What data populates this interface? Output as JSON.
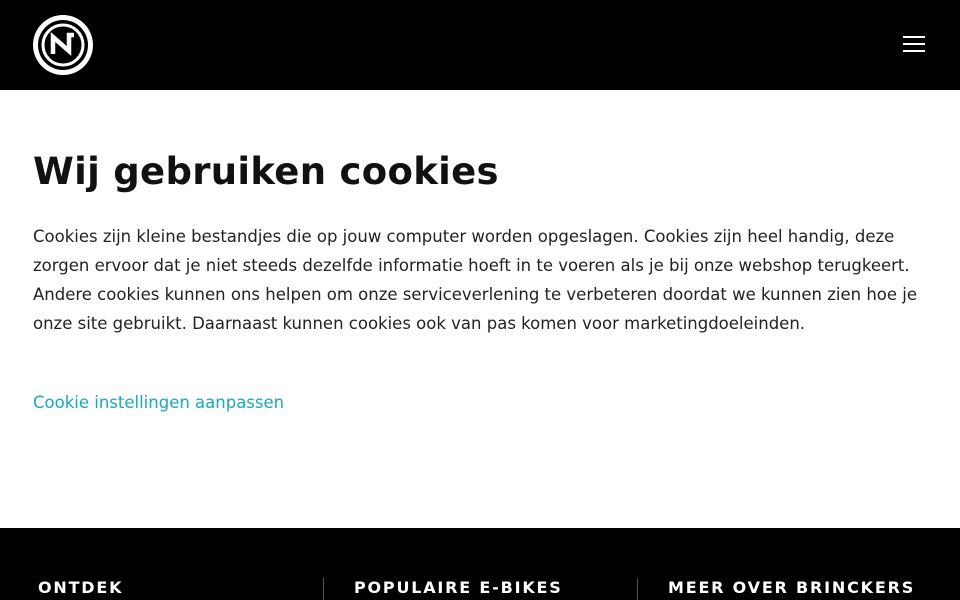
{
  "header": {
    "logo_icon": "brand-logo-icon",
    "menu_icon": "hamburger-menu-icon"
  },
  "main": {
    "title": "Wij gebruiken cookies",
    "body": "Cookies zijn kleine bestandjes die op jouw computer worden opgeslagen. Cookies zijn heel handig, deze zorgen ervoor dat je niet steeds dezelfde informatie hoeft in te voeren als je bij onze webshop terugkeert. Andere cookies kunnen ons helpen om onze serviceverlening te verbeteren doordat we kunnen zien hoe je onze site gebruikt. Daarnaast kunnen cookies ook van pas komen voor marketingdoeleinden.",
    "link_label": "Cookie instellingen aanpassen"
  },
  "footer": {
    "columns": [
      {
        "heading": "ONTDEK"
      },
      {
        "heading": "POPULAIRE E-BIKES"
      },
      {
        "heading": "MEER OVER BRINCKERS"
      }
    ]
  },
  "colors": {
    "header_bg": "#000000",
    "link": "#1aa7bc",
    "text": "#222222"
  }
}
